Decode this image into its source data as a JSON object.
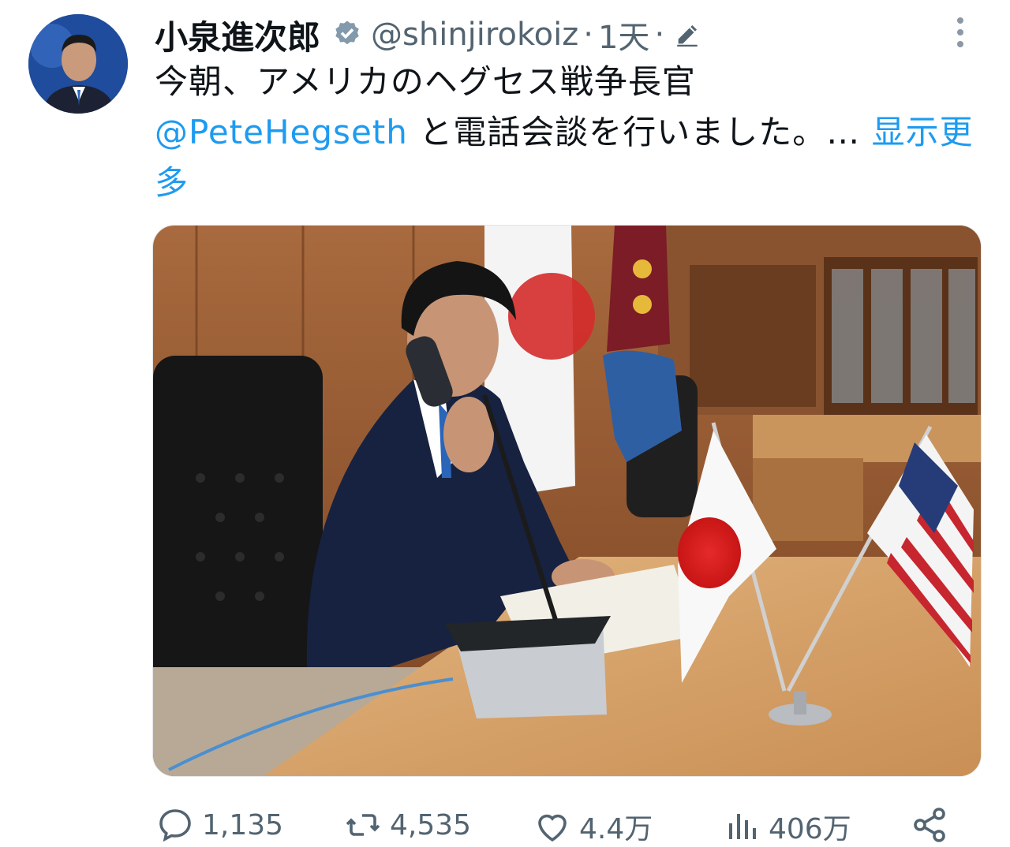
{
  "tweet": {
    "author_name": "小泉進次郎",
    "handle": "@shinjirokoiz",
    "separator": "·",
    "time": "1天",
    "text_line1": "今朝、アメリカのヘグセス戦争長官",
    "mention": "@PeteHegseth",
    "text_line2": " と電話会談を行いました。…",
    "show_more": "显示更多"
  },
  "actions": {
    "replies": "1,135",
    "retweets": "4,535",
    "likes": "4.4万",
    "views": "406万"
  },
  "icons": {
    "verified": "verified-badge-icon",
    "edit": "edit-pencil-icon",
    "more": "more-vertical-icon",
    "reply": "reply-icon",
    "retweet": "retweet-icon",
    "like": "heart-icon",
    "views": "views-bar-chart-icon",
    "share": "share-icon"
  },
  "colors": {
    "accent": "#1d9bf0",
    "secondary_text": "#536471"
  }
}
